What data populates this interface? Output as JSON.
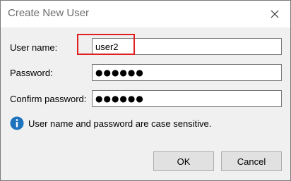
{
  "dialog": {
    "title": "Create New User",
    "close_label": "✕"
  },
  "form": {
    "username": {
      "label": "User name:",
      "value": "user2"
    },
    "password": {
      "label": "Password:",
      "value": "●●●●●●"
    },
    "confirm": {
      "label": "Confirm password:",
      "value": "●●●●●●"
    }
  },
  "info": {
    "icon": "info-icon",
    "text": "User name and password are case sensitive."
  },
  "buttons": {
    "ok": "OK",
    "cancel": "Cancel"
  },
  "colors": {
    "highlight": "#e02020",
    "info_icon": "#1e73be"
  }
}
